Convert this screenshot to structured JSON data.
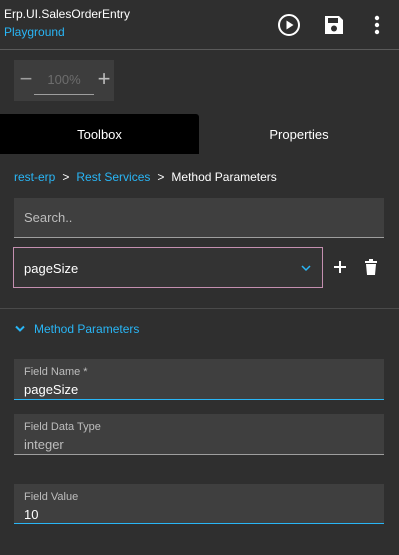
{
  "header": {
    "title": "Erp.UI.SalesOrderEntry",
    "subtitle": "Playground",
    "actions": [
      "play-icon",
      "save-icon",
      "more-vert-icon"
    ]
  },
  "zoom": {
    "minus_label": "−",
    "plus_label": "+",
    "value": "100%"
  },
  "tabs": [
    {
      "label": "Toolbox",
      "active": true
    },
    {
      "label": "Properties",
      "active": false
    }
  ],
  "breadcrumb": {
    "items": [
      "rest-erp",
      "Rest Services"
    ],
    "separator": ">",
    "current": "Method Parameters"
  },
  "search": {
    "placeholder": "Search.."
  },
  "method_select": {
    "value": "pageSize",
    "add_icon": "plus-icon",
    "delete_icon": "trash-icon"
  },
  "section": {
    "label": "Method Parameters",
    "expanded": true
  },
  "fields": {
    "name": {
      "label": "Field Name *",
      "value": "pageSize"
    },
    "type": {
      "label": "Field Data Type",
      "value": "integer"
    },
    "value": {
      "label": "Field Value",
      "value": "10"
    }
  },
  "colors": {
    "accent": "#29b6f6",
    "background": "#2f2f2f",
    "panel": "#3f3f3f",
    "select_border": "#c48fb0"
  }
}
